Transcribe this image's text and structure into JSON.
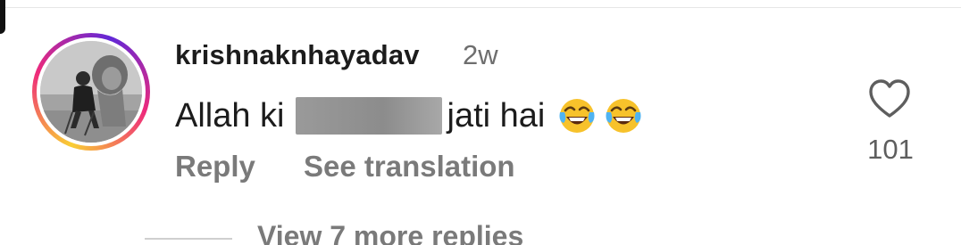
{
  "comment": {
    "username": "krishnaknhayadav",
    "timestamp": "2w",
    "text_before": "Allah ki",
    "text_after": "jati hai",
    "emojis": [
      "face-with-tears-of-joy",
      "face-with-tears-of-joy"
    ],
    "reply_label": "Reply",
    "translate_label": "See translation",
    "like_count": "101"
  },
  "replies": {
    "view_more_label": "View 7 more replies"
  },
  "colors": {
    "text_primary": "#1c1c1c",
    "text_secondary": "#7a7a7a",
    "story_ring": [
      "#f9ce34",
      "#ee2a7b",
      "#6228d7"
    ]
  }
}
